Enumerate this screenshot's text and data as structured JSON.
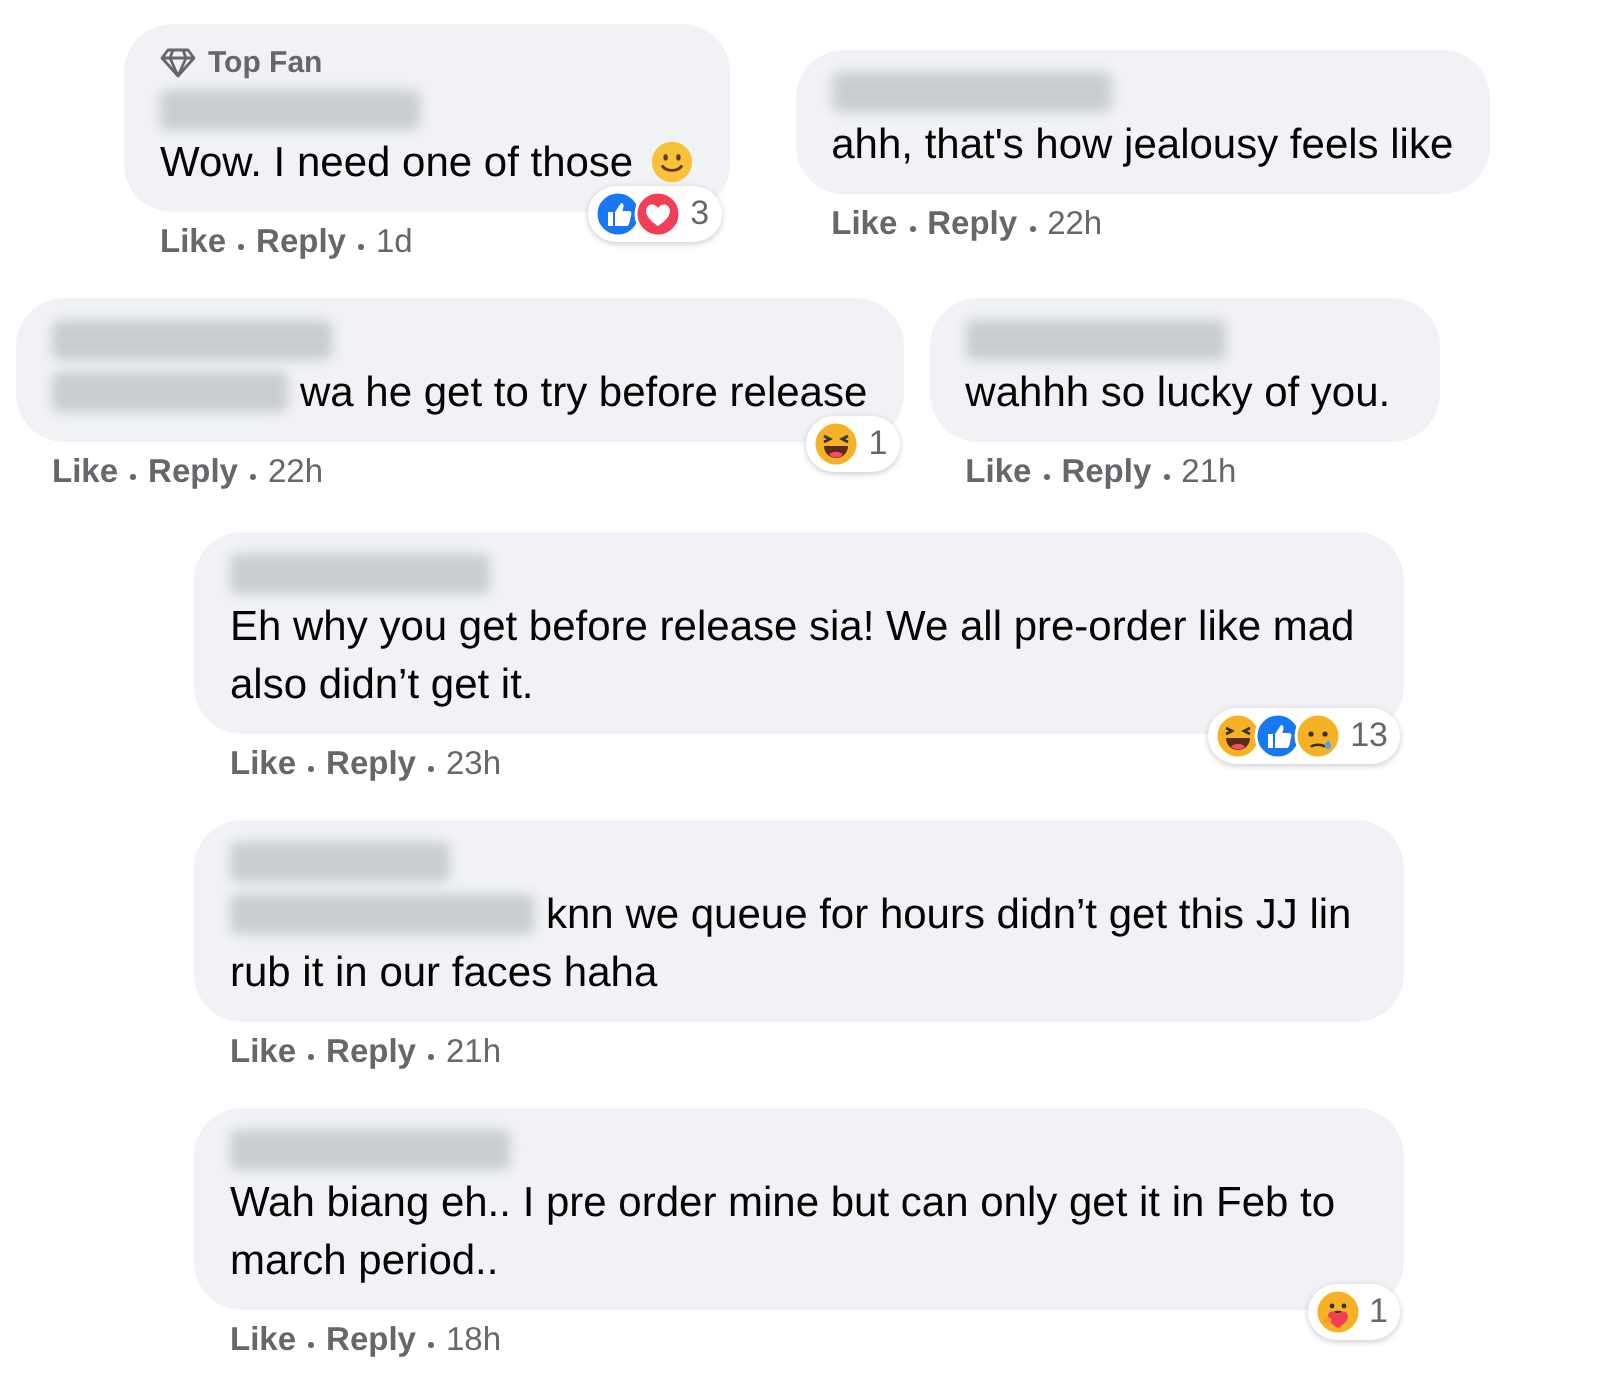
{
  "rows": [
    {
      "comments": [
        {
          "badge": "Top Fan",
          "name_redacted": true,
          "tag_redacted": false,
          "text": "Wow. I need one of those",
          "smiley_after_text": true,
          "reactions": {
            "icons": [
              {
                "kind": "like"
              },
              {
                "kind": "love"
              }
            ],
            "count": "3"
          },
          "like": "Like",
          "reply": "Reply",
          "time": "1d"
        },
        {
          "name_redacted": true,
          "tag_redacted": false,
          "text": "ahh, that's how jealousy feels like",
          "like": "Like",
          "reply": "Reply",
          "time": "22h"
        }
      ]
    },
    {
      "comments": [
        {
          "name_redacted": true,
          "tag_redacted": true,
          "text": "wa he get to try before release",
          "reactions": {
            "icons": [
              {
                "kind": "haha"
              }
            ],
            "count": "1"
          },
          "like": "Like",
          "reply": "Reply",
          "time": "22h"
        },
        {
          "name_redacted": true,
          "tag_redacted": false,
          "text": "wahhh so lucky of you.",
          "like": "Like",
          "reply": "Reply",
          "time": "21h"
        }
      ]
    },
    {
      "comments": [
        {
          "name_redacted": true,
          "tag_redacted": false,
          "text": "Eh why you get before release sia! We all pre-order like mad also didn’t get it.",
          "reactions": {
            "icons": [
              {
                "kind": "haha"
              },
              {
                "kind": "like"
              },
              {
                "kind": "sad"
              }
            ],
            "count": "13"
          },
          "like": "Like",
          "reply": "Reply",
          "time": "23h"
        }
      ]
    },
    {
      "comments": [
        {
          "name_redacted": true,
          "tag_redacted": true,
          "text": "knn we queue for hours didn’t get this JJ lin rub it in our faces haha",
          "like": "Like",
          "reply": "Reply",
          "time": "21h"
        }
      ]
    },
    {
      "comments": [
        {
          "name_redacted": true,
          "tag_redacted": false,
          "text": "Wah biang eh.. I pre order mine but can only get it in Feb to march period..",
          "reactions": {
            "icons": [
              {
                "kind": "care"
              }
            ],
            "count": "1"
          },
          "like": "Like",
          "reply": "Reply",
          "time": "18h"
        }
      ]
    }
  ]
}
